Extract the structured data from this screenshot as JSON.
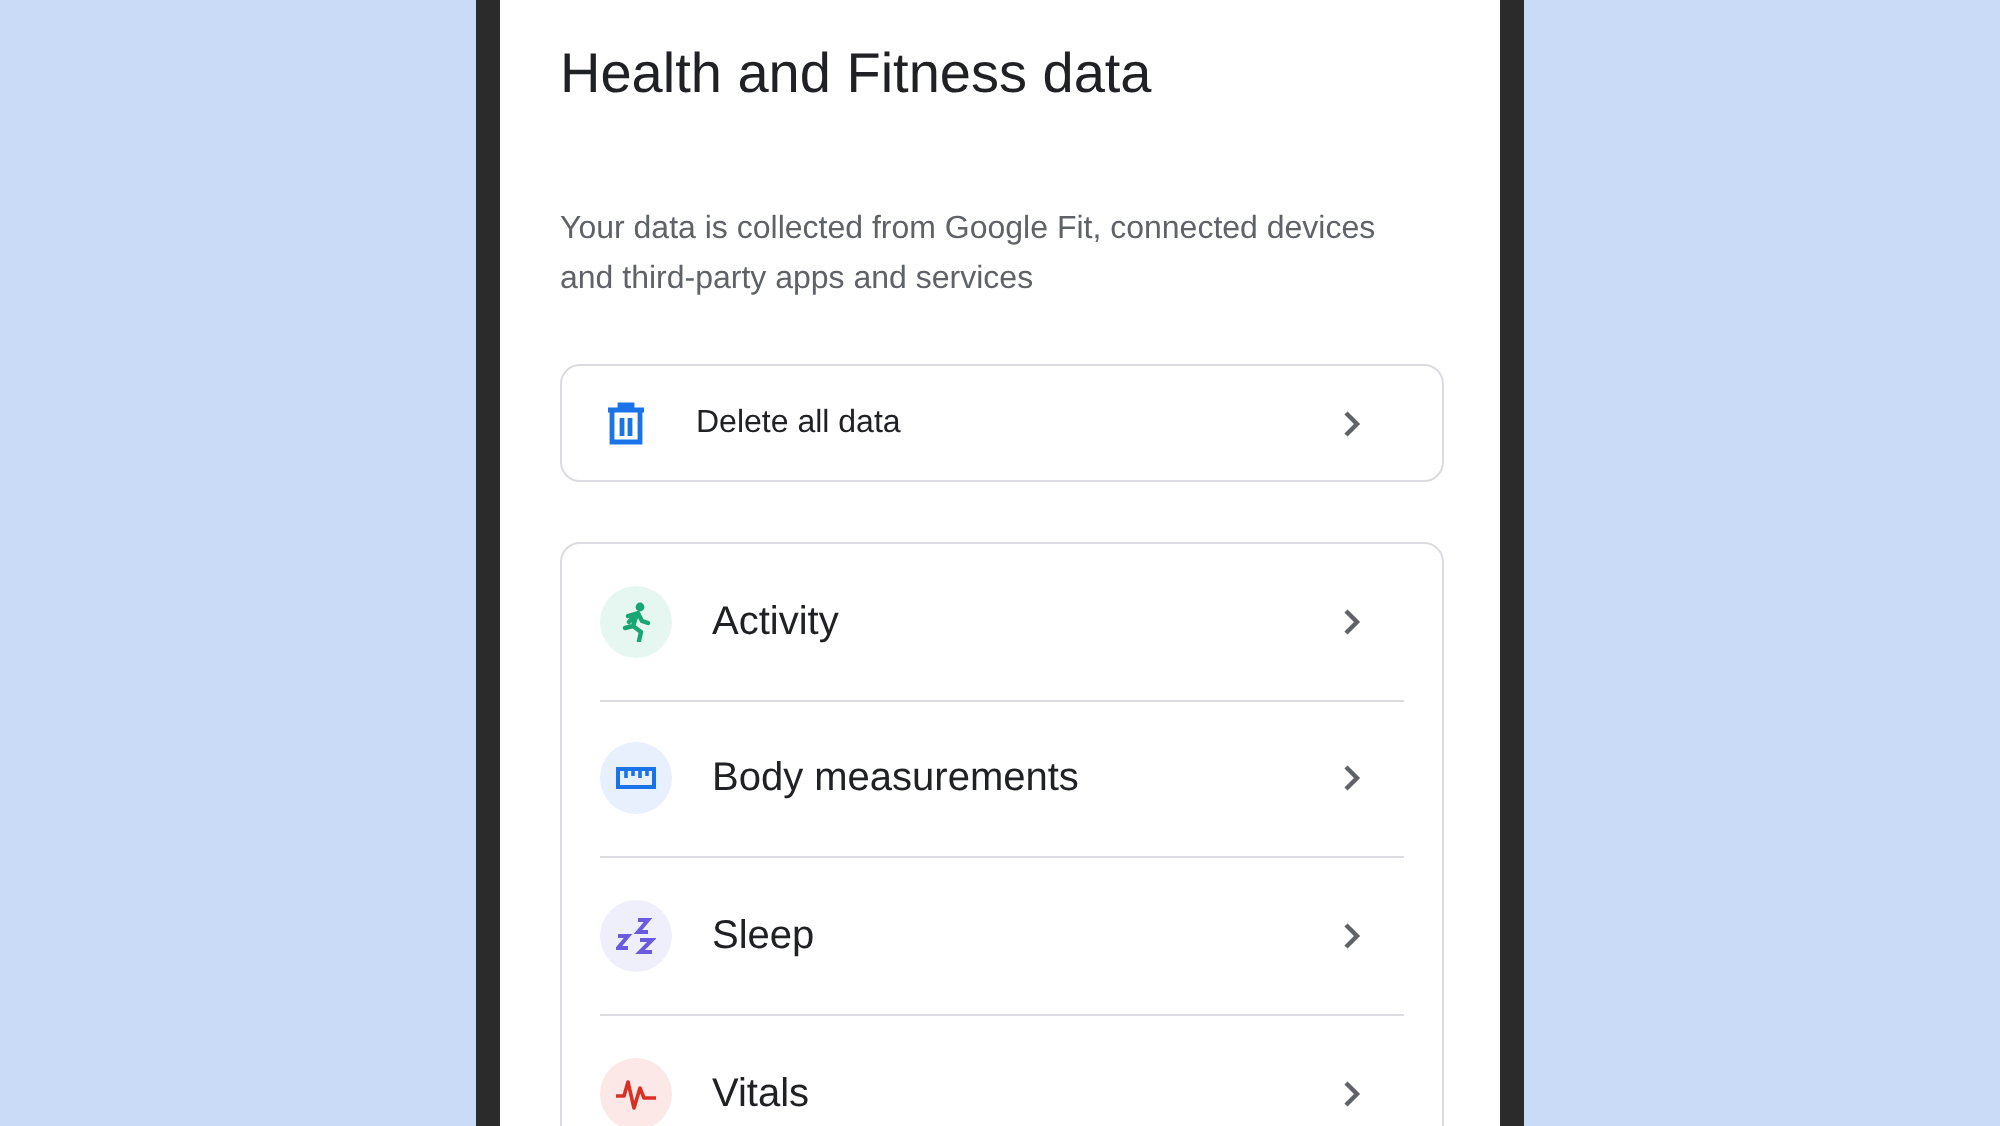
{
  "title": "Health and Fitness data",
  "description": "Your data is collected from Google Fit, connected devices and third-party apps and services",
  "delete_action": {
    "label": "Delete all data"
  },
  "categories": [
    {
      "kind": "activity",
      "label": "Activity"
    },
    {
      "kind": "body",
      "label": "Body measurements"
    },
    {
      "kind": "sleep",
      "label": "Sleep"
    },
    {
      "kind": "vitals",
      "label": "Vitals"
    }
  ]
}
